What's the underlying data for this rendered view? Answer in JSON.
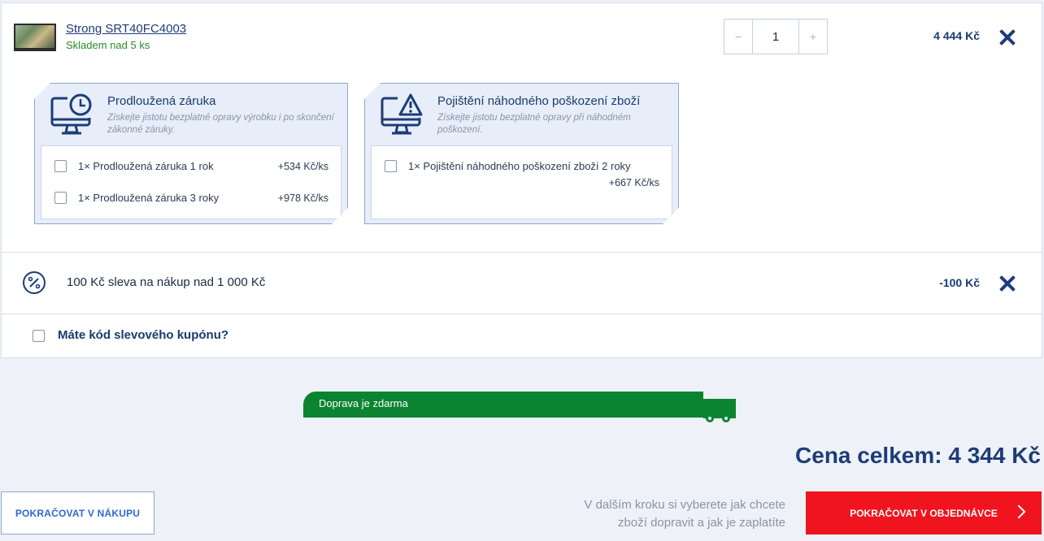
{
  "product": {
    "name": "Strong SRT40FC4003",
    "stock": "Skladem nad 5 ks",
    "quantity": "1",
    "qty_minus": "−",
    "qty_plus": "+",
    "price": "4 444 Kč"
  },
  "services": [
    {
      "icon": "monitor-clock-icon",
      "title": "Prodloužená záruka",
      "description": "Získejte jistotu bezplatné opravy výrobku i po skončení zákonné záruky.",
      "options": [
        {
          "label": "1× Prodloužená záruka 1 rok",
          "price": "+534 Kč/ks",
          "checked": false
        },
        {
          "label": "1× Prodloužená záruka 3 roky",
          "price": "+978 Kč/ks",
          "checked": false
        }
      ]
    },
    {
      "icon": "monitor-warning-icon",
      "title": "Pojištění náhodného poškození zboží",
      "description": "Získejte jistotu bezplatné opravy při náhodném poškození.",
      "options": [
        {
          "label": "1× Pojištění náhodného poškození zboží 2 roky",
          "price": "+667 Kč/ks",
          "checked": false
        }
      ]
    }
  ],
  "discount": {
    "icon": "percent-icon",
    "label": "100 Kč sleva na nákup nad 1 000 Kč",
    "price": "-100 Kč"
  },
  "coupon": {
    "label": "Máte kód slevového kupónu?",
    "checked": false
  },
  "shipping": {
    "label": "Doprava je zdarma",
    "icon": "truck-icon"
  },
  "total": {
    "label": "Cena celkem: 4 344 Kč"
  },
  "actions": {
    "continue_shopping": "POKRAČOVAT V NÁKUPU",
    "next_note": "V dalším kroku si vyberete jak chcete zboží dopravit a jak je zaplatíte",
    "continue_order": "POKRAČOVAT V OBJEDNÁVCE"
  },
  "colors": {
    "brand_blue": "#1d3c78",
    "accent_blue": "#2d6ad3",
    "cta_red": "#f0141e",
    "shipping_green": "#0b8431",
    "stock_green": "#2a8a2a"
  }
}
